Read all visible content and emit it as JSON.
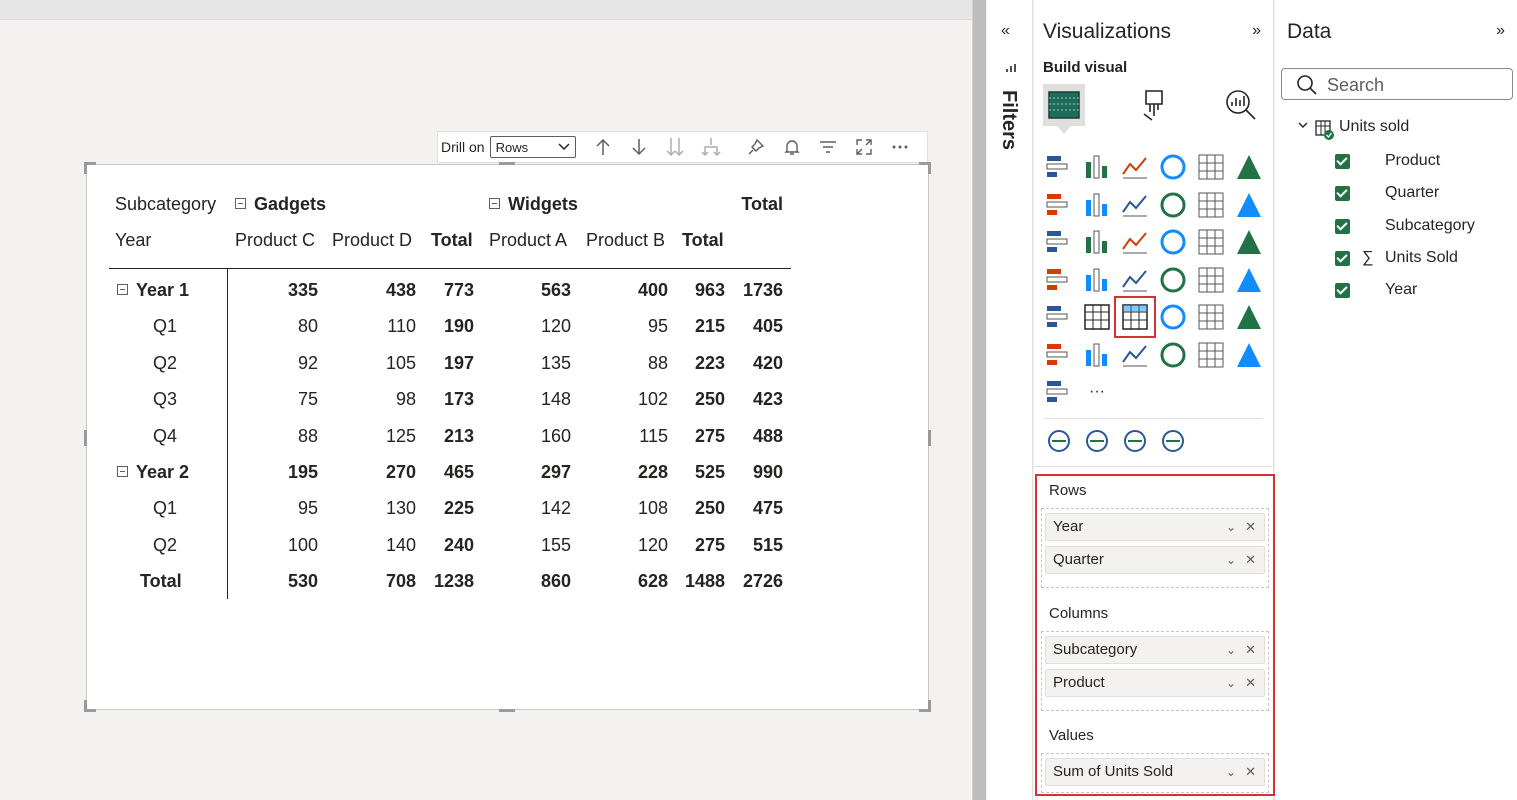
{
  "visual_header": {
    "drill_label": "Drill on",
    "drill_value": "Rows"
  },
  "matrix": {
    "header1": {
      "subcategory_label": "Subcategory",
      "gadgets": "Gadgets",
      "widgets": "Widgets",
      "total": "Total"
    },
    "header2": {
      "year_label": "Year",
      "product_c": "Product C",
      "product_d": "Product D",
      "gadgets_total": "Total",
      "product_a": "Product A",
      "product_b": "Product B",
      "widgets_total": "Total"
    },
    "rows": [
      {
        "label": "Year 1",
        "level": 0,
        "values": [
          "335",
          "438",
          "773",
          "563",
          "400",
          "963",
          "1736"
        ]
      },
      {
        "label": "Q1",
        "level": 1,
        "values": [
          "80",
          "110",
          "190",
          "120",
          "95",
          "215",
          "405"
        ]
      },
      {
        "label": "Q2",
        "level": 1,
        "values": [
          "92",
          "105",
          "197",
          "135",
          "88",
          "223",
          "420"
        ]
      },
      {
        "label": "Q3",
        "level": 1,
        "values": [
          "75",
          "98",
          "173",
          "148",
          "102",
          "250",
          "423"
        ]
      },
      {
        "label": "Q4",
        "level": 1,
        "values": [
          "88",
          "125",
          "213",
          "160",
          "115",
          "275",
          "488"
        ]
      },
      {
        "label": "Year 2",
        "level": 0,
        "values": [
          "195",
          "270",
          "465",
          "297",
          "228",
          "525",
          "990"
        ]
      },
      {
        "label": "Q1",
        "level": 1,
        "values": [
          "95",
          "130",
          "225",
          "142",
          "108",
          "250",
          "475"
        ]
      },
      {
        "label": "Q2",
        "level": 1,
        "values": [
          "100",
          "140",
          "240",
          "155",
          "120",
          "275",
          "515"
        ]
      },
      {
        "label": "Total",
        "level": 2,
        "values": [
          "530",
          "708",
          "1238",
          "860",
          "628",
          "1488",
          "2726"
        ]
      }
    ]
  },
  "filters_pane": {
    "label": "Filters"
  },
  "visualizations": {
    "title": "Visualizations",
    "build_visual": "Build visual",
    "more": "···"
  },
  "wells": {
    "rows": {
      "title": "Rows",
      "fields": [
        "Year",
        "Quarter"
      ]
    },
    "columns": {
      "title": "Columns",
      "fields": [
        "Subcategory",
        "Product"
      ]
    },
    "values": {
      "title": "Values",
      "fields": [
        "Sum of Units Sold"
      ]
    }
  },
  "data_pane": {
    "title": "Data",
    "search_placeholder": "Search",
    "table": "Units sold",
    "fields": [
      "Product",
      "Quarter",
      "Subcategory",
      "Units Sold",
      "Year"
    ]
  },
  "colors": {
    "accent_red": "#d13438",
    "check_green": "#217346"
  }
}
